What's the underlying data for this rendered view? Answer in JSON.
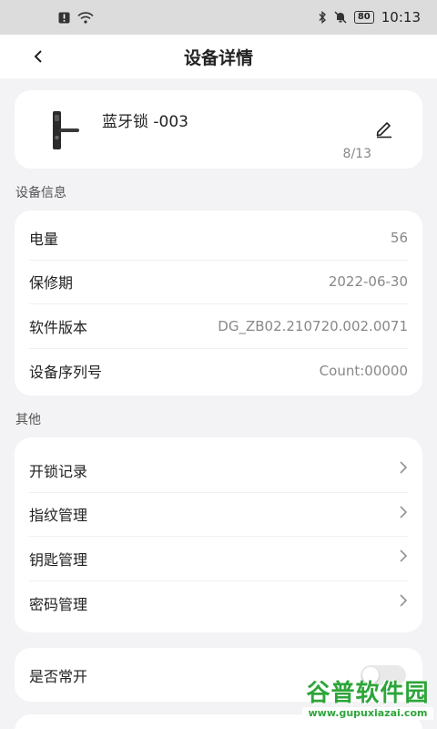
{
  "status_bar": {
    "time": "10:13",
    "battery": "80"
  },
  "header": {
    "title": "设备详情"
  },
  "device": {
    "name": "蓝牙锁 -003",
    "name_count": "8/13"
  },
  "sections": {
    "info_label": "设备信息",
    "other_label": "其他"
  },
  "info_rows": [
    {
      "label": "电量",
      "value": "56"
    },
    {
      "label": "保修期",
      "value": "2022-06-30"
    },
    {
      "label": "软件版本",
      "value": "DG_ZB02.210720.002.0071"
    },
    {
      "label": "设备序列号",
      "value": "Count:00000"
    }
  ],
  "other_rows": [
    {
      "label": "开锁记录"
    },
    {
      "label": "指纹管理"
    },
    {
      "label": "钥匙管理"
    },
    {
      "label": "密码管理"
    }
  ],
  "toggle_row": {
    "label": "是否常开",
    "on": false
  },
  "watermark": {
    "title": "谷普软件园",
    "url": "www.gupuxiazai.com"
  },
  "colors": {
    "background": "#f3f3f5",
    "card": "#ffffff",
    "watermark_green": "#2da53a"
  }
}
